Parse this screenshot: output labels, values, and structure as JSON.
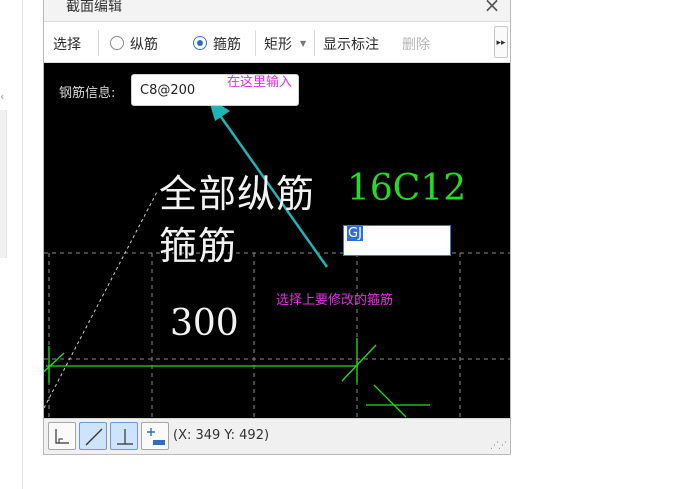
{
  "window": {
    "title": "截面编辑"
  },
  "toolbar": {
    "select_label": "选择",
    "longitudinal_label": "纵筋",
    "stirrup_label": "箍筋",
    "stirrup_checked": true,
    "shape_label": "矩形",
    "show_annotation_label": "显示标注",
    "delete_label": "删除",
    "more_label": "▸▸"
  },
  "canvas": {
    "rebar_info_label": "钢筋信息:",
    "rebar_info_value": "C8@200",
    "hint_input": "在这里输入",
    "hint_select": "选择上要修改的箍筋",
    "text_all_longitudinal": "全部纵筋",
    "text_stirrup": "箍筋",
    "text_longitudinal_value": "16C12",
    "text_dimension": "300",
    "stirrup_edit_value": "GJ"
  },
  "statusbar": {
    "coordinates": "(X: 349 Y: 492)"
  },
  "colors": {
    "canvas_bg": "#000000",
    "annotation_magenta": "#e030e0",
    "arrow_cyan": "#1fb5b8",
    "rebar_green": "#22dd22",
    "accent_blue": "#2d6ec0"
  }
}
